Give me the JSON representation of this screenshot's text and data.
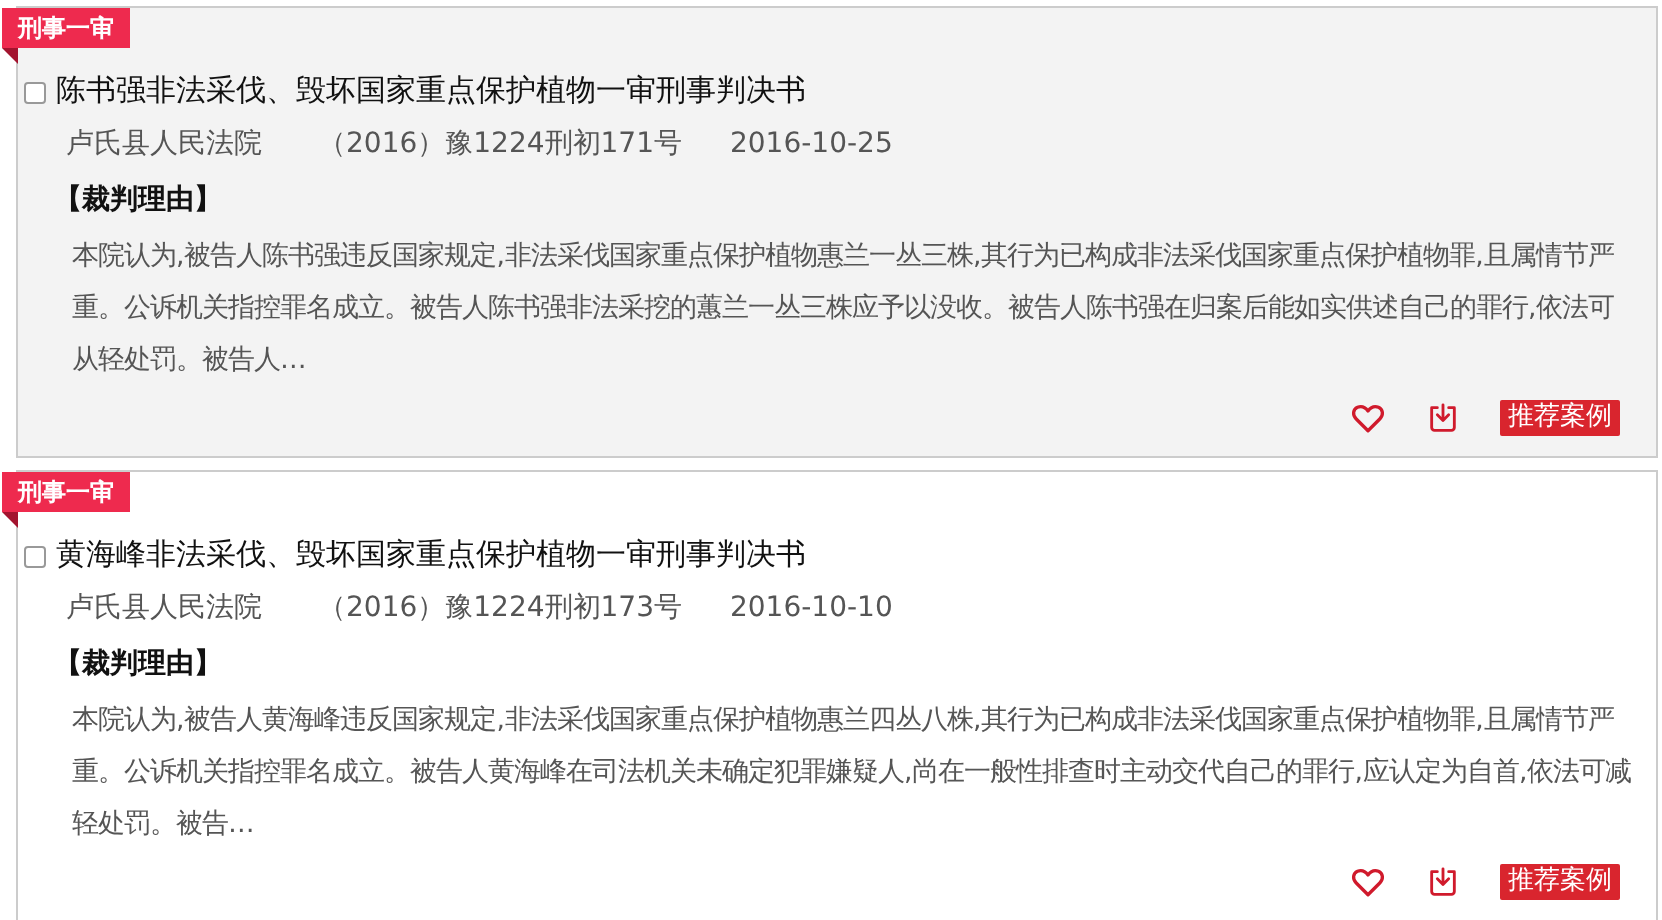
{
  "cases": [
    {
      "tag": "刑事一审",
      "highlighted": true,
      "checked": false,
      "title": "陈书强非法采伐、毁坏国家重点保护植物一审刑事判决书",
      "court": "卢氏县人民法院",
      "case_no": "（2016）豫1224刑初171号",
      "date": "2016-10-25",
      "reason_heading": "【裁判理由】",
      "reason": "本院认为,被告人陈书强违反国家规定,非法采伐国家重点保护植物惠兰一丛三株,其行为已构成非法采伐国家重点保护植物罪,且属情节严重。公诉机关指控罪名成立。被告人陈书强非法采挖的蕙兰一丛三株应予以没收。被告人陈书强在归案后能如实供述自己的罪行,依法可从轻处罚。被告人…",
      "badge": "推荐案例"
    },
    {
      "tag": "刑事一审",
      "highlighted": false,
      "checked": false,
      "title": "黄海峰非法采伐、毁坏国家重点保护植物一审刑事判决书",
      "court": "卢氏县人民法院",
      "case_no": "（2016）豫1224刑初173号",
      "date": "2016-10-10",
      "reason_heading": "【裁判理由】",
      "reason": "本院认为,被告人黄海峰违反国家规定,非法采伐国家重点保护植物惠兰四丛八株,其行为已构成非法采伐国家重点保护植物罪,且属情节严重。公诉机关指控罪名成立。被告人黄海峰在司法机关未确定犯罪嫌疑人,尚在一般性排查时主动交代自己的罪行,应认定为自首,依法可减轻处罚。被告…",
      "badge": "推荐案例"
    }
  ]
}
